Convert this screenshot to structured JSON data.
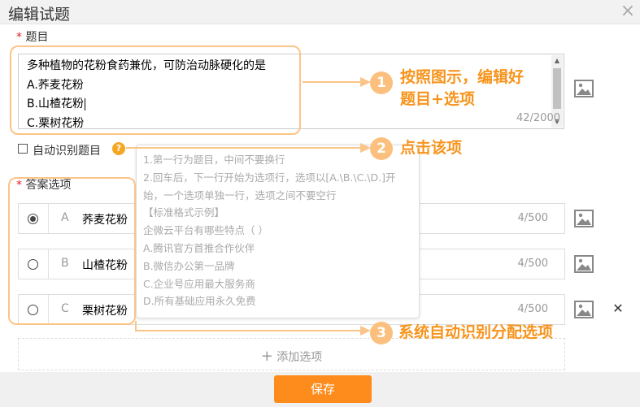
{
  "dialog": {
    "title": "编辑试题",
    "close_icon": "×"
  },
  "question": {
    "required_mark": "*",
    "label": "题目",
    "lines": [
      "多种植物的花粉食药兼优，可防治动脉硬化的是",
      "A.荞麦花粉",
      "B.山楂花粉",
      "C.栗树花粉"
    ],
    "counter": "42/2000"
  },
  "auto_recognize": {
    "label": "自动识别题目",
    "help_icon": "?"
  },
  "tooltip": {
    "lines": [
      "1.第一行为题目，中间不要换行",
      "2.回车后，下一行开始为选项行，选项以[A.\\B.\\C.\\D.]开",
      "始，一个选项单独一行，选项之间不要空行",
      "【标准格式示例】",
      "企微云平台有哪些特点（ ）",
      "A.腾讯官方首推合作伙伴",
      "B.微信办公第一品牌",
      "C.企业号应用最大服务商",
      "D.所有基础应用永久免费"
    ]
  },
  "answers": {
    "required_mark": "*",
    "label": "答案选项",
    "options": [
      {
        "letter": "A",
        "text": "荞麦花粉",
        "counter": "4/500",
        "selected": true
      },
      {
        "letter": "B",
        "text": "山楂花粉",
        "counter": "4/500",
        "selected": false
      },
      {
        "letter": "C",
        "text": "栗树花粉",
        "counter": "4/500",
        "selected": false
      }
    ],
    "delete_icon": "✕",
    "add_label": "添加选项",
    "add_icon": "+"
  },
  "footer": {
    "save_label": "保存"
  },
  "annotations": [
    {
      "num": "1",
      "line1": "按照图示，编辑好",
      "line2": "题目+选项"
    },
    {
      "num": "2",
      "line1": "点击该项"
    },
    {
      "num": "3",
      "line1": "系统自动识别分配选项"
    }
  ],
  "colors": {
    "accent": "#fd8c1c",
    "annotation": "#f7941d",
    "highlight": "#fbc488",
    "required": "#e02020"
  }
}
